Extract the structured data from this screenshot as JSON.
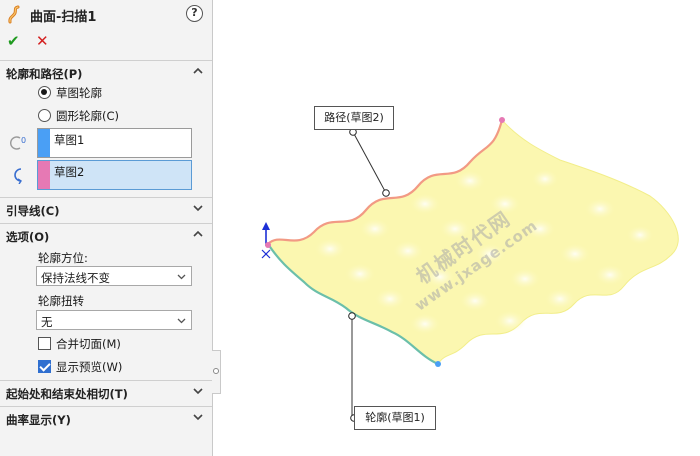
{
  "title": "曲面-扫描1",
  "actions": {
    "help": "?",
    "ok": "✔",
    "cancel": "✕"
  },
  "sections": {
    "profile_path": {
      "header": "轮廓和路径(P)",
      "radio_sketch": "草图轮廓",
      "radio_circle": "圆形轮廓(C)",
      "profile_value": "草图1",
      "path_value": "草图2",
      "profile_color": "#4a9ff5",
      "path_color": "#e679b4"
    },
    "guide_curves": {
      "header": "引导线(C)"
    },
    "options": {
      "header": "选项(O)",
      "orientation_label": "轮廓方位:",
      "orientation_value": "保持法线不变",
      "twist_label": "轮廓扭转",
      "twist_value": "无",
      "merge_faces": "合并切面(M)",
      "show_preview": "显示预览(W)"
    },
    "tangency": {
      "header": "起始处和结束处相切(T)"
    },
    "curvature": {
      "header": "曲率显示(Y)"
    }
  },
  "viewport": {
    "callout_path": "路径(草图2)",
    "callout_profile": "轮廓(草图1)",
    "watermark_line1": "机械时代网",
    "watermark_line2": "www.jxage.com",
    "surface_color": "#fbf7b0",
    "path_edge_color": "#f29a84",
    "profile_edge_color": "#6bbfaa",
    "triad_color": "#1c2fd6"
  }
}
